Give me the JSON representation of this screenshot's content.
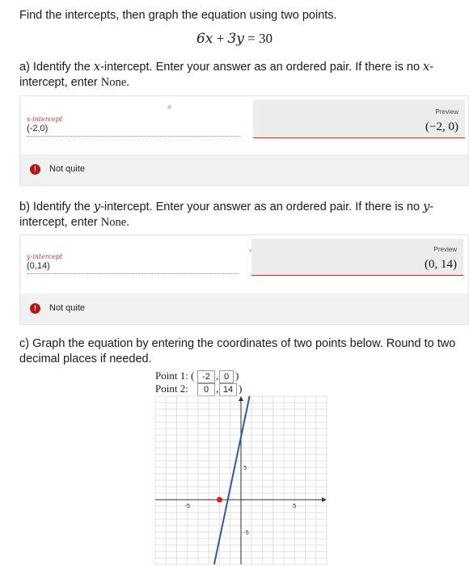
{
  "instructions": "Find the intercepts, then graph the equation using two points.",
  "equation": "6x + 3y = 30",
  "part_a": {
    "prompt_1": "a) Identify the ",
    "var": "x",
    "prompt_2": "-intercept. Enter your answer as an ordered pair. If there is no ",
    "var2": "x",
    "prompt_3": "-",
    "prompt_4": "intercept, enter ",
    "none_word": "None",
    "prompt_end": ".",
    "field_label": "x-intercept",
    "field_value": "(-2,0)",
    "preview_label": "Preview",
    "preview_value": "(−2, 0)",
    "feedback": "Not quite"
  },
  "part_b": {
    "prompt_1": "b) Identify the ",
    "var": "y",
    "prompt_2": "-intercept. Enter your answer as an ordered pair. If there is no ",
    "var2": "y",
    "prompt_3": "-",
    "prompt_4": "intercept, enter ",
    "none_word": "None",
    "prompt_end": ".",
    "field_label": "y-intercept",
    "field_value": "(0,14)",
    "preview_label": "Preview",
    "preview_value": "(0, 14)",
    "feedback": "Not quite"
  },
  "part_c": {
    "prompt_line1": "c) Graph the equation by entering the coordinates of two points below. Round to two",
    "prompt_line2": "decimal places if needed.",
    "point1_label": "Point 1:",
    "point1_x": "-2",
    "point1_y": "0",
    "point2_label": "Point 2:",
    "point2_x": "0",
    "point2_y": "14",
    "open_paren": "(",
    "comma": ",",
    "close_paren": ")"
  },
  "graph": {
    "tick_labels": {
      "x_neg": "-5",
      "x_pos": "5",
      "y_pos": "5",
      "y_neg": "-5"
    },
    "x_range": [
      -8,
      8
    ],
    "y_range": [
      -10,
      16
    ],
    "line_points": [
      [
        -2.5,
        -10
      ],
      [
        0.8,
        16
      ]
    ],
    "plotted_points": [
      [
        -2,
        0
      ]
    ],
    "line_color": "#3a55a8",
    "point_color": "#d32020"
  }
}
